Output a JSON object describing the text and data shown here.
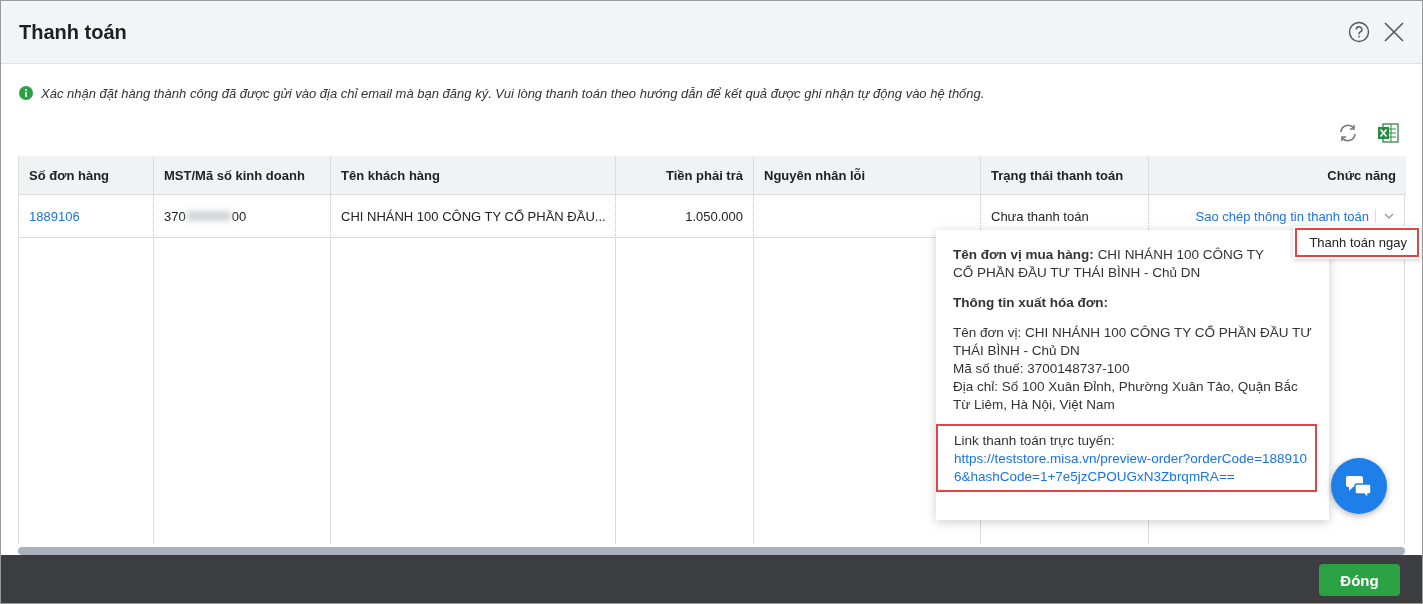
{
  "window": {
    "title": "Thanh toán"
  },
  "notice": "Xác nhận đặt hàng thành công đã được gửi vào địa chỉ email mà bạn đăng ký. Vui lòng thanh toán theo hướng dẫn để kết quả được ghi nhận tự động vào hệ thống.",
  "table": {
    "columns": [
      {
        "label": "Số đơn hàng"
      },
      {
        "label": "MST/Mã số kinh doanh"
      },
      {
        "label": "Tên khách hàng"
      },
      {
        "label": "Tiền phải trả"
      },
      {
        "label": "Nguyên nhân lỗi"
      },
      {
        "label": "Trạng thái thanh toán"
      },
      {
        "label": "Chức năng"
      }
    ],
    "rows": [
      {
        "order_no": "1889106",
        "tax_code_start": "370",
        "tax_code_end": "00",
        "customer": "CHI NHÁNH 100 CÔNG TY CỔ PHẦN ĐẦU...",
        "amount": "1.050.000",
        "status": "Chưa thanh toán",
        "action": "Sao chép thông tin thanh toán"
      }
    ]
  },
  "action_menu": {
    "items": [
      {
        "label": "Thanh toán ngay",
        "highlighted": true
      }
    ]
  },
  "payment_popup": {
    "buyer_label": "Tên đơn vị mua hàng:",
    "buyer_value": "CHI NHÁNH 100 CÔNG TY CỔ PHẦN ĐẦU TƯ THÁI BÌNH - Chủ DN",
    "invoice_heading": "Thông tin xuất hóa đơn:",
    "invoice_lines": [
      "Tên đơn vị: CHI NHÁNH 100 CÔNG TY CỔ PHẦN ĐẦU TƯ THÁI BÌNH - Chủ DN",
      "Mã số thuế: 3700148737-100",
      "Địa chỉ: Số 100 Xuân Đỉnh, Phường Xuân Tảo, Quận Bắc Từ Liêm, Hà Nội, Việt Nam"
    ],
    "link_label": "Link thanh toán trực tuyến:",
    "link": "https://teststore.misa.vn/preview-order?orderCode=1889106&hashCode=1+7e5jzCPOUGxN3ZbrqmRA==",
    "highlighted": true
  },
  "footer": {
    "close_button": "Đóng"
  }
}
